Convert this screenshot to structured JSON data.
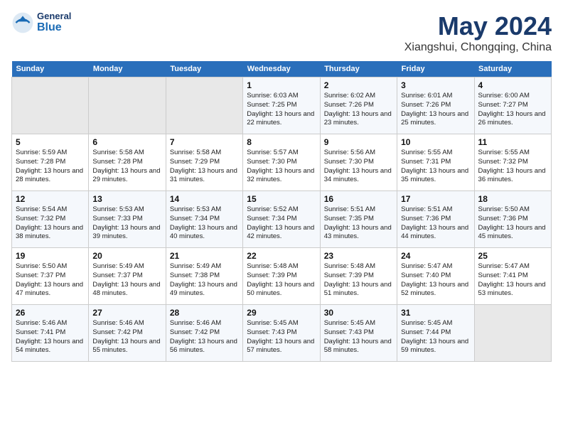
{
  "header": {
    "logo_general": "General",
    "logo_blue": "Blue",
    "month": "May 2024",
    "location": "Xiangshui, Chongqing, China"
  },
  "weekdays": [
    "Sunday",
    "Monday",
    "Tuesday",
    "Wednesday",
    "Thursday",
    "Friday",
    "Saturday"
  ],
  "weeks": [
    [
      {
        "day": "",
        "info": ""
      },
      {
        "day": "",
        "info": ""
      },
      {
        "day": "",
        "info": ""
      },
      {
        "day": "1",
        "info": "Sunrise: 6:03 AM\nSunset: 7:25 PM\nDaylight: 13 hours and 22 minutes."
      },
      {
        "day": "2",
        "info": "Sunrise: 6:02 AM\nSunset: 7:26 PM\nDaylight: 13 hours and 23 minutes."
      },
      {
        "day": "3",
        "info": "Sunrise: 6:01 AM\nSunset: 7:26 PM\nDaylight: 13 hours and 25 minutes."
      },
      {
        "day": "4",
        "info": "Sunrise: 6:00 AM\nSunset: 7:27 PM\nDaylight: 13 hours and 26 minutes."
      }
    ],
    [
      {
        "day": "5",
        "info": "Sunrise: 5:59 AM\nSunset: 7:28 PM\nDaylight: 13 hours and 28 minutes."
      },
      {
        "day": "6",
        "info": "Sunrise: 5:58 AM\nSunset: 7:28 PM\nDaylight: 13 hours and 29 minutes."
      },
      {
        "day": "7",
        "info": "Sunrise: 5:58 AM\nSunset: 7:29 PM\nDaylight: 13 hours and 31 minutes."
      },
      {
        "day": "8",
        "info": "Sunrise: 5:57 AM\nSunset: 7:30 PM\nDaylight: 13 hours and 32 minutes."
      },
      {
        "day": "9",
        "info": "Sunrise: 5:56 AM\nSunset: 7:30 PM\nDaylight: 13 hours and 34 minutes."
      },
      {
        "day": "10",
        "info": "Sunrise: 5:55 AM\nSunset: 7:31 PM\nDaylight: 13 hours and 35 minutes."
      },
      {
        "day": "11",
        "info": "Sunrise: 5:55 AM\nSunset: 7:32 PM\nDaylight: 13 hours and 36 minutes."
      }
    ],
    [
      {
        "day": "12",
        "info": "Sunrise: 5:54 AM\nSunset: 7:32 PM\nDaylight: 13 hours and 38 minutes."
      },
      {
        "day": "13",
        "info": "Sunrise: 5:53 AM\nSunset: 7:33 PM\nDaylight: 13 hours and 39 minutes."
      },
      {
        "day": "14",
        "info": "Sunrise: 5:53 AM\nSunset: 7:34 PM\nDaylight: 13 hours and 40 minutes."
      },
      {
        "day": "15",
        "info": "Sunrise: 5:52 AM\nSunset: 7:34 PM\nDaylight: 13 hours and 42 minutes."
      },
      {
        "day": "16",
        "info": "Sunrise: 5:51 AM\nSunset: 7:35 PM\nDaylight: 13 hours and 43 minutes."
      },
      {
        "day": "17",
        "info": "Sunrise: 5:51 AM\nSunset: 7:36 PM\nDaylight: 13 hours and 44 minutes."
      },
      {
        "day": "18",
        "info": "Sunrise: 5:50 AM\nSunset: 7:36 PM\nDaylight: 13 hours and 45 minutes."
      }
    ],
    [
      {
        "day": "19",
        "info": "Sunrise: 5:50 AM\nSunset: 7:37 PM\nDaylight: 13 hours and 47 minutes."
      },
      {
        "day": "20",
        "info": "Sunrise: 5:49 AM\nSunset: 7:37 PM\nDaylight: 13 hours and 48 minutes."
      },
      {
        "day": "21",
        "info": "Sunrise: 5:49 AM\nSunset: 7:38 PM\nDaylight: 13 hours and 49 minutes."
      },
      {
        "day": "22",
        "info": "Sunrise: 5:48 AM\nSunset: 7:39 PM\nDaylight: 13 hours and 50 minutes."
      },
      {
        "day": "23",
        "info": "Sunrise: 5:48 AM\nSunset: 7:39 PM\nDaylight: 13 hours and 51 minutes."
      },
      {
        "day": "24",
        "info": "Sunrise: 5:47 AM\nSunset: 7:40 PM\nDaylight: 13 hours and 52 minutes."
      },
      {
        "day": "25",
        "info": "Sunrise: 5:47 AM\nSunset: 7:41 PM\nDaylight: 13 hours and 53 minutes."
      }
    ],
    [
      {
        "day": "26",
        "info": "Sunrise: 5:46 AM\nSunset: 7:41 PM\nDaylight: 13 hours and 54 minutes."
      },
      {
        "day": "27",
        "info": "Sunrise: 5:46 AM\nSunset: 7:42 PM\nDaylight: 13 hours and 55 minutes."
      },
      {
        "day": "28",
        "info": "Sunrise: 5:46 AM\nSunset: 7:42 PM\nDaylight: 13 hours and 56 minutes."
      },
      {
        "day": "29",
        "info": "Sunrise: 5:45 AM\nSunset: 7:43 PM\nDaylight: 13 hours and 57 minutes."
      },
      {
        "day": "30",
        "info": "Sunrise: 5:45 AM\nSunset: 7:43 PM\nDaylight: 13 hours and 58 minutes."
      },
      {
        "day": "31",
        "info": "Sunrise: 5:45 AM\nSunset: 7:44 PM\nDaylight: 13 hours and 59 minutes."
      },
      {
        "day": "",
        "info": ""
      }
    ]
  ]
}
